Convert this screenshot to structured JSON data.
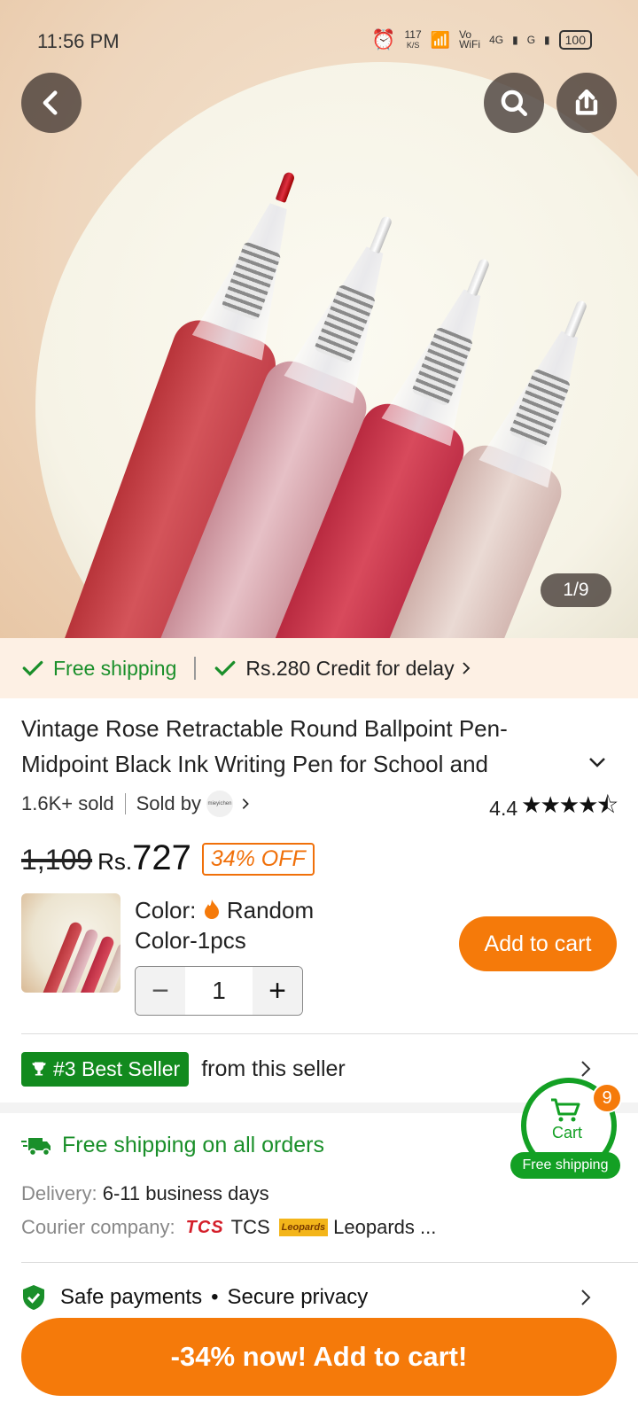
{
  "status_bar": {
    "time": "11:56 PM",
    "speed": "117",
    "speed_unit": "K/S",
    "vowifi": "Vo WiFi",
    "network_1": "4G",
    "network_2": "G",
    "battery": "100"
  },
  "gallery": {
    "counter": "1/9",
    "icons": [
      "back-icon",
      "search-icon",
      "share-icon"
    ]
  },
  "shipping_strip": {
    "free_shipping": "Free shipping",
    "credit": "Rs.280 Credit for delay"
  },
  "product": {
    "title": "Vintage Rose Retractable Round Ballpoint Pen-Midpoint Black Ink Writing Pen for School and",
    "sold": "1.6K+ sold",
    "sold_by_label": "Sold by",
    "seller_logo_text": "mieyichen",
    "rating": "4.4",
    "rating_value": 4.4,
    "stars": "★★★★⯪"
  },
  "price": {
    "old": "1,109",
    "currency": "Rs.",
    "current": "727",
    "discount": "34% OFF"
  },
  "variant": {
    "color_label": "Color:",
    "color_value_1": "Random",
    "color_value_2": "Color-1pcs",
    "quantity": "1",
    "minus": "−",
    "plus": "+",
    "add_to_cart": "Add to cart"
  },
  "best_seller": {
    "badge": "#3 Best Seller",
    "text": "from this seller"
  },
  "shipping_info": {
    "title": "Free shipping on all orders",
    "delivery_label": "Delivery:",
    "delivery_value": "6-11 business days",
    "courier_label": "Courier company:",
    "courier_1_logo": "TCS",
    "courier_1": "TCS",
    "courier_2_logo": "Leopards",
    "courier_2": "Leopards ..."
  },
  "safe_payments": {
    "text_1": "Safe payments",
    "bullet": "•",
    "text_2": "Secure privacy"
  },
  "floating_cart": {
    "count": "9",
    "label": "Cart",
    "free_shipping": "Free shipping"
  },
  "bottom_cta": {
    "label": "-34% now! Add to cart!"
  },
  "colors": {
    "accent_orange": "#f57a0a",
    "green": "#13a024"
  }
}
